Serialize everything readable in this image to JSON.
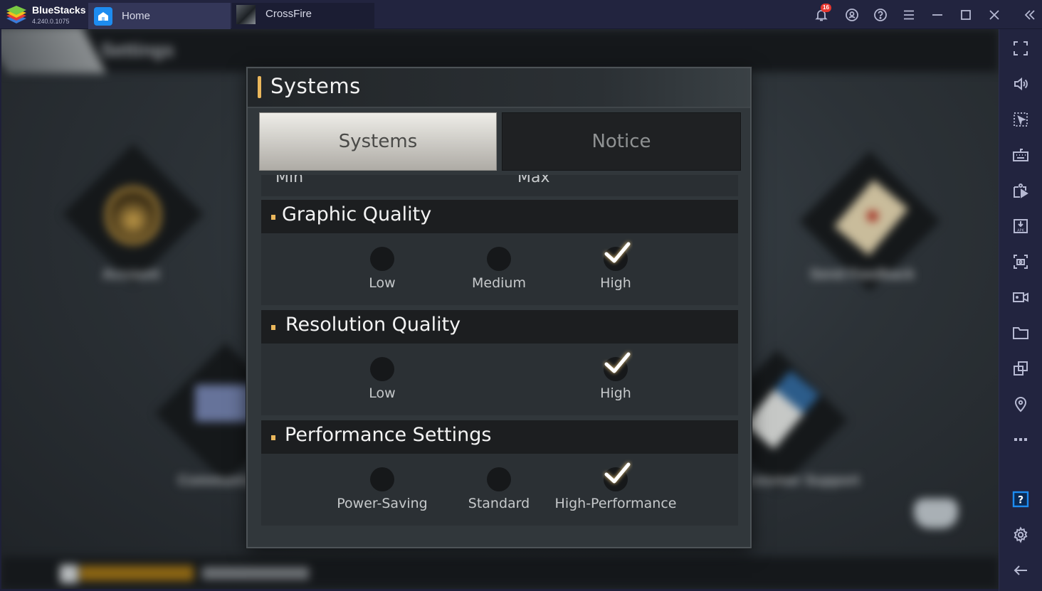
{
  "app": {
    "name": "BlueStacks",
    "version": "4.240.0.1075"
  },
  "tabs": [
    {
      "label": "Home",
      "icon": "home-icon",
      "active": false
    },
    {
      "label": "CrossFire",
      "icon": "crossfire-game-icon",
      "active": true
    }
  ],
  "titlebar_icons": [
    {
      "name": "notification-bell-icon",
      "badge": "16"
    },
    {
      "name": "account-icon"
    },
    {
      "name": "help-icon"
    },
    {
      "name": "menu-icon"
    },
    {
      "name": "minimize-icon"
    },
    {
      "name": "maximize-icon"
    },
    {
      "name": "close-icon"
    },
    {
      "name": "collapse-sidebar-icon"
    }
  ],
  "sidebar_icons": [
    "fullscreen-icon",
    "volume-icon",
    "pointer-icon",
    "keyboard-icon",
    "media-manager-icon",
    "install-apk-icon",
    "screenshot-icon",
    "record-video-icon",
    "folder-icon",
    "multi-instance-icon",
    "location-icon",
    "more-icon",
    "help-box-icon",
    "settings-gear-icon",
    "back-arrow-icon"
  ],
  "background": {
    "page_title": "Settings",
    "tiles": [
      "Account",
      "Send Feedback",
      "Community",
      "Customer Support"
    ],
    "footer_player": "PlayerXXXX"
  },
  "modal": {
    "title": "Systems",
    "tabs": [
      {
        "label": "Systems",
        "selected": true
      },
      {
        "label": "Notice",
        "selected": false
      }
    ],
    "slider_labels": {
      "min": "Min",
      "max": "Max"
    },
    "sections": [
      {
        "title": "Graphic Quality",
        "options": [
          {
            "label": "Low",
            "checked": false
          },
          {
            "label": "Medium",
            "checked": false
          },
          {
            "label": "High",
            "checked": true
          }
        ]
      },
      {
        "title": "Resolution Quality",
        "options": [
          {
            "label": "Low",
            "checked": false
          },
          {
            "label": "High",
            "checked": true
          }
        ]
      },
      {
        "title": "Performance Settings",
        "options": [
          {
            "label": "Power-Saving",
            "checked": false
          },
          {
            "label": "Standard",
            "checked": false
          },
          {
            "label": "High-Performance",
            "checked": true
          }
        ]
      }
    ]
  },
  "colors": {
    "accent_gold": "#eab75c",
    "bluestacks_blue": "#1d8cf0",
    "notification_red": "#e8372f",
    "chrome_bg": "#22243f"
  }
}
